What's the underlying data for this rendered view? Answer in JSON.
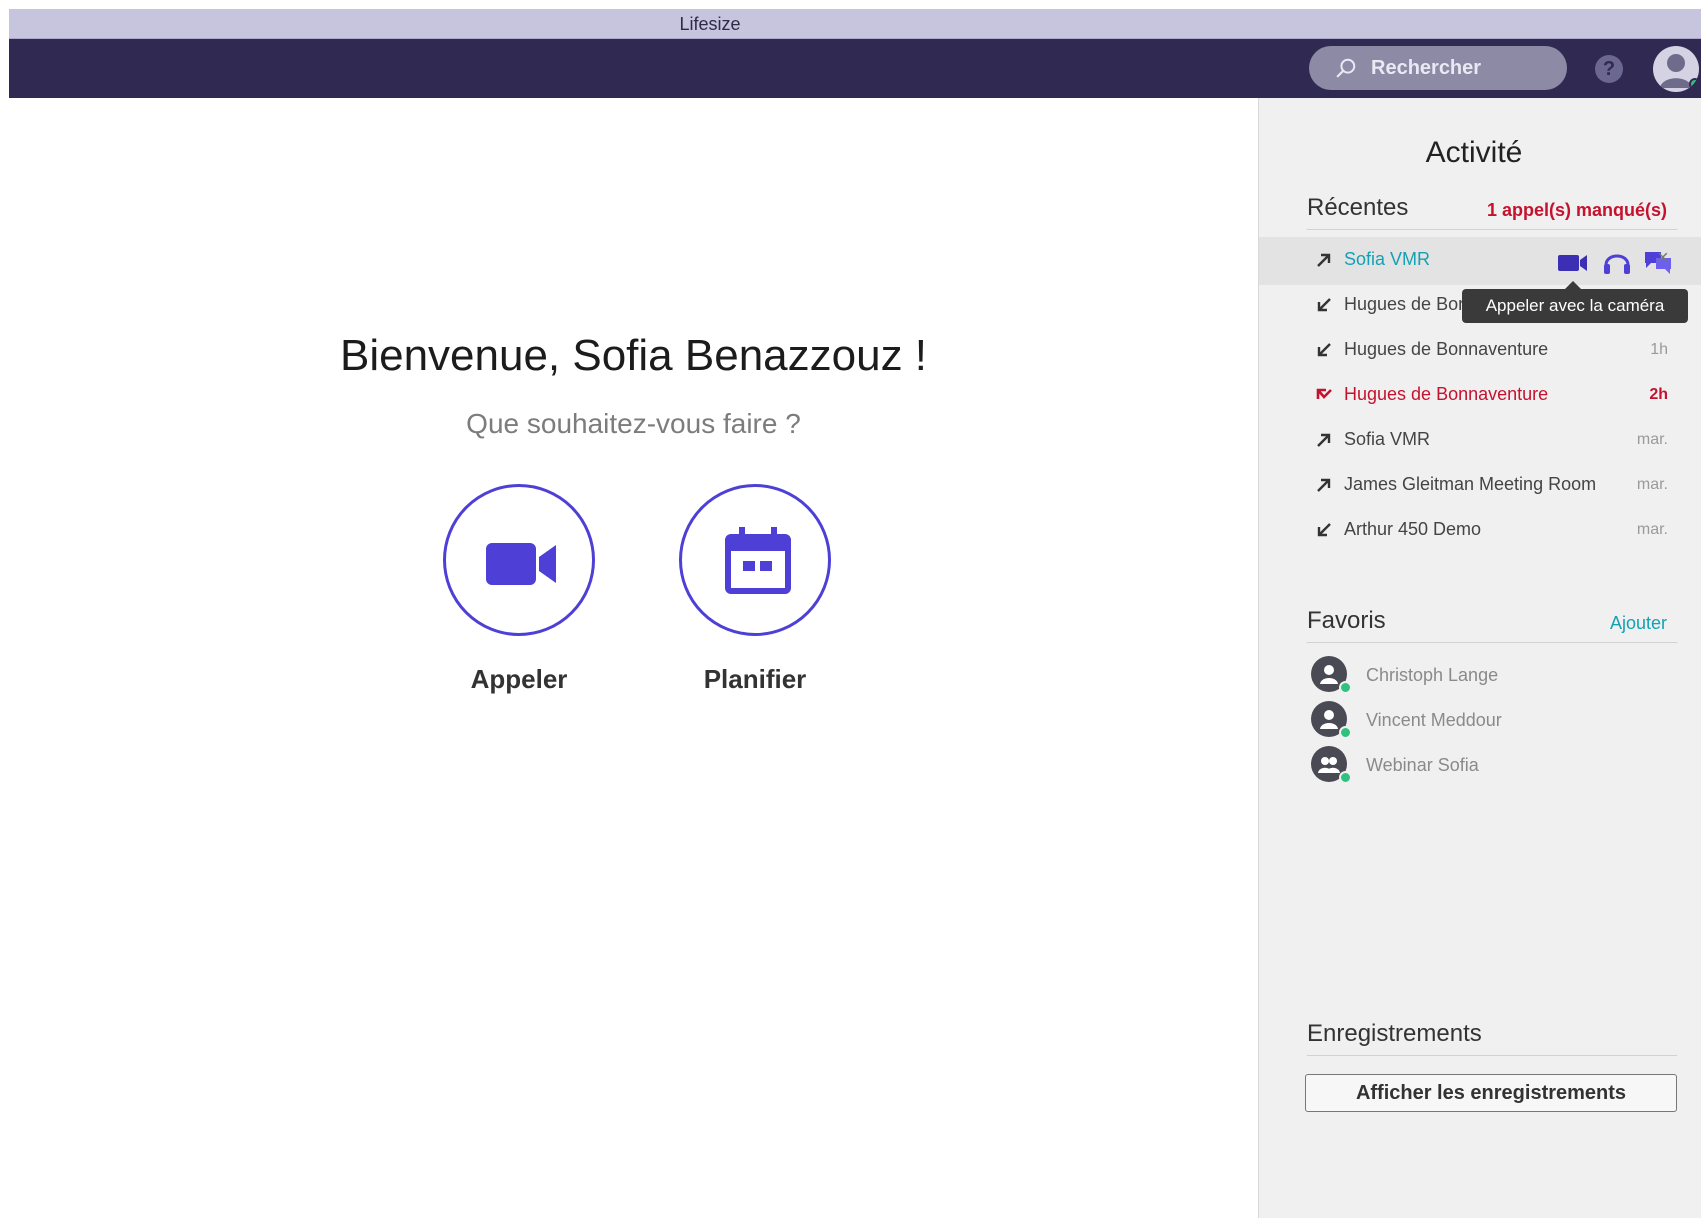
{
  "app": {
    "title": "Lifesize"
  },
  "topbar": {
    "search_placeholder": "Rechercher",
    "help_glyph": "?"
  },
  "main": {
    "welcome": "Bienvenue, Sofia Benazzouz !",
    "subtitle": "Que souhaitez-vous faire ?",
    "actions": [
      {
        "label": "Appeler",
        "icon": "video-camera-icon"
      },
      {
        "label": "Planifier",
        "icon": "calendar-icon"
      }
    ]
  },
  "activity": {
    "title": "Activité",
    "recent": {
      "header": "Récentes",
      "missed_summary": "1 appel(s) manqué(s)",
      "tooltip": "Appeler avec la caméra",
      "items": [
        {
          "direction": "outgoing",
          "name": "Sofia VMR",
          "time": ""
        },
        {
          "direction": "incoming",
          "name": "Hugues de Bonnaventure",
          "time": ""
        },
        {
          "direction": "incoming",
          "name": "Hugues de Bonnaventure",
          "time": "1h"
        },
        {
          "direction": "missed",
          "name": "Hugues de Bonnaventure",
          "time": "2h"
        },
        {
          "direction": "outgoing",
          "name": "Sofia VMR",
          "time": "mar."
        },
        {
          "direction": "outgoing",
          "name": "James Gleitman Meeting Room",
          "time": "mar."
        },
        {
          "direction": "incoming",
          "name": "Arthur 450 Demo",
          "time": "mar."
        }
      ]
    },
    "favorites": {
      "header": "Favoris",
      "add_label": "Ajouter",
      "items": [
        {
          "name": "Christoph Lange",
          "status": "online"
        },
        {
          "name": "Vincent Meddour",
          "status": "online"
        },
        {
          "name": "Webinar Sofia",
          "status": "online"
        }
      ]
    },
    "recordings": {
      "header": "Enregistrements",
      "button_label": "Afficher les enregistrements"
    }
  },
  "colors": {
    "accent": "#4e3fd6",
    "topbar": "#302a52",
    "missed": "#c4122f",
    "link": "#14a1b4",
    "online": "#2ec27e"
  }
}
